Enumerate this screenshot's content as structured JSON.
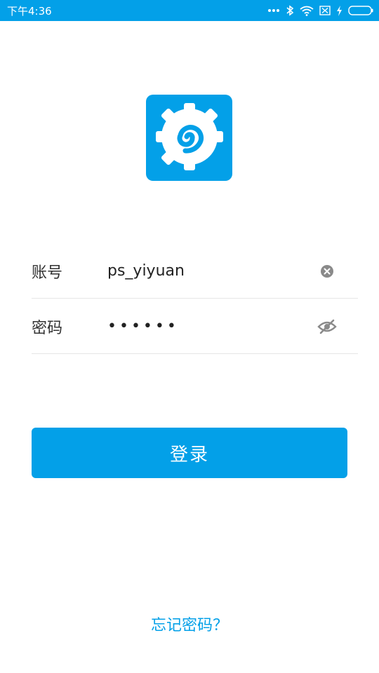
{
  "status_bar": {
    "time": "下午4:36",
    "icons": [
      "more-dots-icon",
      "bluetooth-icon",
      "wifi-icon",
      "no-sim-icon",
      "charging-icon",
      "battery-icon"
    ]
  },
  "logo": {
    "icon": "app-logo-gear-swirl"
  },
  "form": {
    "account_label": "账号",
    "account_value": "ps_yiyuan",
    "password_label": "密码",
    "password_mask": "••••••"
  },
  "login_button": {
    "label": "登录"
  },
  "forgot_password": {
    "label": "忘记密码？"
  },
  "colors": {
    "accent": "#03a0e8",
    "divider": "#e6e6e6",
    "icon_gray": "#8a8a8a"
  }
}
